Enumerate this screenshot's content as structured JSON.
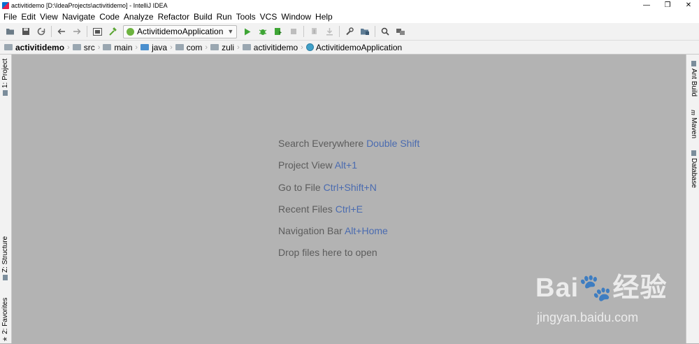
{
  "window": {
    "title": "activitidemo [D:\\IdeaProjects\\activitidemo] - IntelliJ IDEA",
    "controls": [
      "—",
      "❐",
      "✕"
    ]
  },
  "menu": [
    "File",
    "Edit",
    "View",
    "Navigate",
    "Code",
    "Analyze",
    "Refactor",
    "Build",
    "Run",
    "Tools",
    "VCS",
    "Window",
    "Help"
  ],
  "toolbar": {
    "run_config": "ActivitidemoApplication"
  },
  "breadcrumb": [
    "activitidemo",
    "src",
    "main",
    "java",
    "com",
    "zuli",
    "activitidemo",
    "ActivitidemoApplication"
  ],
  "left_tabs": {
    "project": "1: Project",
    "structure": "Z: Structure",
    "favorites": "2: Favorites"
  },
  "right_tabs": {
    "ant": "Ant Build",
    "maven": "Maven",
    "database": "Database"
  },
  "hints": [
    {
      "label": "Search Everywhere",
      "key": "Double Shift"
    },
    {
      "label": "Project View",
      "key": "Alt+1"
    },
    {
      "label": "Go to File",
      "key": "Ctrl+Shift+N"
    },
    {
      "label": "Recent Files",
      "key": "Ctrl+E"
    },
    {
      "label": "Navigation Bar",
      "key": "Alt+Home"
    },
    {
      "label": "Drop files here to open",
      "key": ""
    }
  ],
  "watermark": {
    "logo": "Bai🐾经验",
    "url": "jingyan.baidu.com"
  }
}
